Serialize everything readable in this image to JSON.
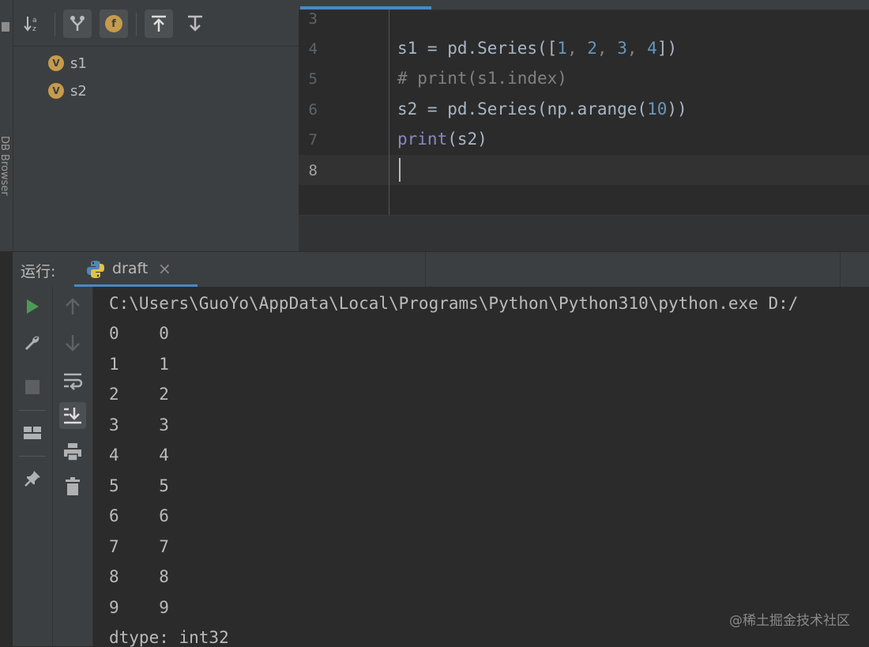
{
  "sidebar_strip": {
    "label": "DB Browser"
  },
  "structure": {
    "items": [
      {
        "badge": "V",
        "name": "s1"
      },
      {
        "badge": "V",
        "name": "s2"
      }
    ]
  },
  "editor": {
    "lines": [
      {
        "no": "3"
      },
      {
        "no": "4"
      },
      {
        "no": "5"
      },
      {
        "no": "6"
      },
      {
        "no": "7"
      },
      {
        "no": "8"
      }
    ],
    "code": {
      "l4_a": "s1 = pd.Series([",
      "l4_n1": "1",
      "l4_c1": ", ",
      "l4_n2": "2",
      "l4_c2": ", ",
      "l4_n3": "3",
      "l4_c3": ", ",
      "l4_n4": "4",
      "l4_b": "])",
      "l5": "# print(s1.index)",
      "l6_a": "s2 = pd.Series(np.arange(",
      "l6_n": "10",
      "l6_b": "))",
      "l7_fn": "print",
      "l7_b": "(s2)"
    }
  },
  "run": {
    "label": "运行:",
    "tab_name": "draft",
    "tab_close": "×"
  },
  "console": {
    "lines": [
      "C:\\Users\\GuoYo\\AppData\\Local\\Programs\\Python\\Python310\\python.exe D:/",
      "0    0",
      "1    1",
      "2    2",
      "3    3",
      "4    4",
      "5    5",
      "6    6",
      "7    7",
      "8    8",
      "9    9",
      "dtype: int32"
    ]
  },
  "watermark": "@稀土掘金技术社区",
  "colors": {
    "accent": "#4a88c7",
    "run_green": "#499c54",
    "var_badge": "#c69b4b"
  }
}
